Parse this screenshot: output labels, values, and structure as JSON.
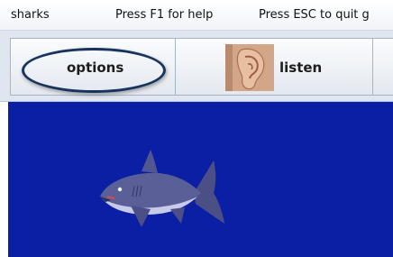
{
  "titlebar": {
    "app_name": "sharks",
    "help_hint": "Press F1 for help",
    "quit_hint": "Press ESC to quit g"
  },
  "toolbar": {
    "options_label": "options",
    "listen_label": "listen",
    "listen_icon": "ear-icon"
  },
  "scene": {
    "background": "#0a1fa3",
    "sprite": "shark-icon"
  },
  "colors": {
    "highlight_ring": "#16345c",
    "toolbar_bg": "#dfe6ef"
  }
}
